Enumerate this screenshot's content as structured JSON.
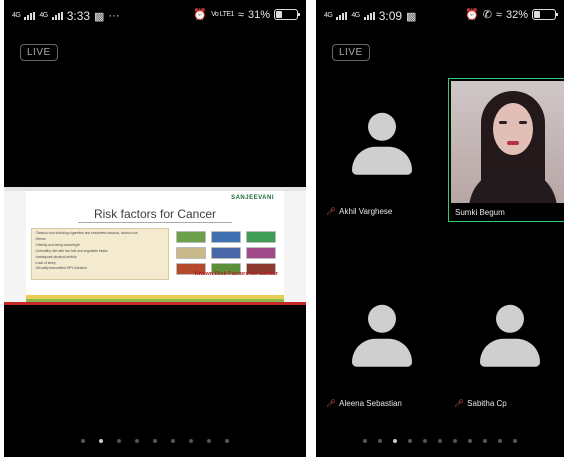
{
  "left_phone": {
    "status": {
      "network": "4G",
      "network2": "4G",
      "time": "3:33",
      "extra": "···",
      "volte": "Vo LTE1",
      "battery": "31%",
      "battery_fraction": 0.31
    },
    "live_badge": "LIVE",
    "slide": {
      "brand": "SANJEEVANI",
      "title": "Risk factors for Cancer",
      "factors": [
        "Tobacco use including cigarettes and smokeless tobacco, alcohol use",
        "Stress",
        "Obesity and being overweight",
        "Unhealthy diet with low fruit and vegetable intake",
        "Inadequate physical activity",
        "Lack of sleep",
        "Sexually transmitted HPV infection"
      ],
      "known_label": "Known Risk Factors for Cancer"
    },
    "page_dots": {
      "count": 9,
      "active": 1
    }
  },
  "right_phone": {
    "status": {
      "network": "4G",
      "network2": "4G",
      "time": "3:09",
      "battery": "32%",
      "battery_fraction": 0.32
    },
    "live_badge": "LIVE",
    "participants": [
      {
        "name": "Akhil Varghese"
      },
      {
        "name": "Sumki Begum"
      },
      {
        "name": "Aleena Sebastian"
      },
      {
        "name": "Sabitha Cp"
      }
    ],
    "page_dots": {
      "count": 11,
      "active": 2
    }
  },
  "colors": {
    "active_speaker": "#2ecc71",
    "muted_mic": "#d9534f",
    "slide_title": "#3e3e3e",
    "known_label": "#b22222"
  }
}
